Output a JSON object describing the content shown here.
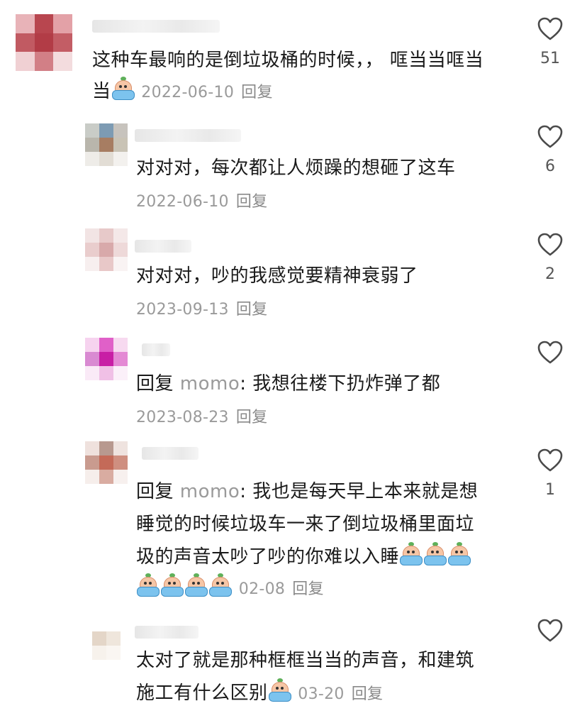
{
  "comments": [
    {
      "text_line1": "这种车最响的是倒垃圾桶的时候，，  哐当当哐当",
      "text_line2": "当",
      "date": "2022-06-10",
      "reply": "回复",
      "likes": "51",
      "emoji_count": 1
    },
    {
      "text_line1": "对对对，每次都让人烦躁的想砸了这车",
      "date": "2022-06-10",
      "reply": "回复",
      "likes": "6"
    },
    {
      "text_line1": "对对对，吵的我感觉要精神衰弱了",
      "date": "2023-09-13",
      "reply": "回复",
      "likes": "2"
    },
    {
      "reply_prefix": "回复",
      "mention": "momo",
      "text_line1": ": 我想往楼下扔炸弹了都",
      "date": "2023-08-23",
      "reply": "回复",
      "likes": ""
    },
    {
      "reply_prefix": "回复",
      "mention": "momo",
      "text_line1": ": 我也是每天早上本来就是想",
      "text_line2": "睡觉的时候垃圾车一来了倒垃圾桶里面垃",
      "text_line3": "圾的声音太吵了吵的你难以入睡",
      "date": "02-08",
      "reply": "回复",
      "likes": "1"
    },
    {
      "text_line1": "太对了就是那种框框当当的声音，和建筑",
      "text_line2": "施工有什么区别",
      "date": "03-20",
      "reply": "回复",
      "likes": ""
    }
  ],
  "icons": {
    "like": "heart-outline-icon",
    "emoji": "crying-bath-emoji-icon"
  },
  "colors": {
    "text": "#1a1a1a",
    "meta": "#9a9a9a",
    "mention": "#9a9a9a",
    "heart_stroke": "#4a4a4a"
  }
}
